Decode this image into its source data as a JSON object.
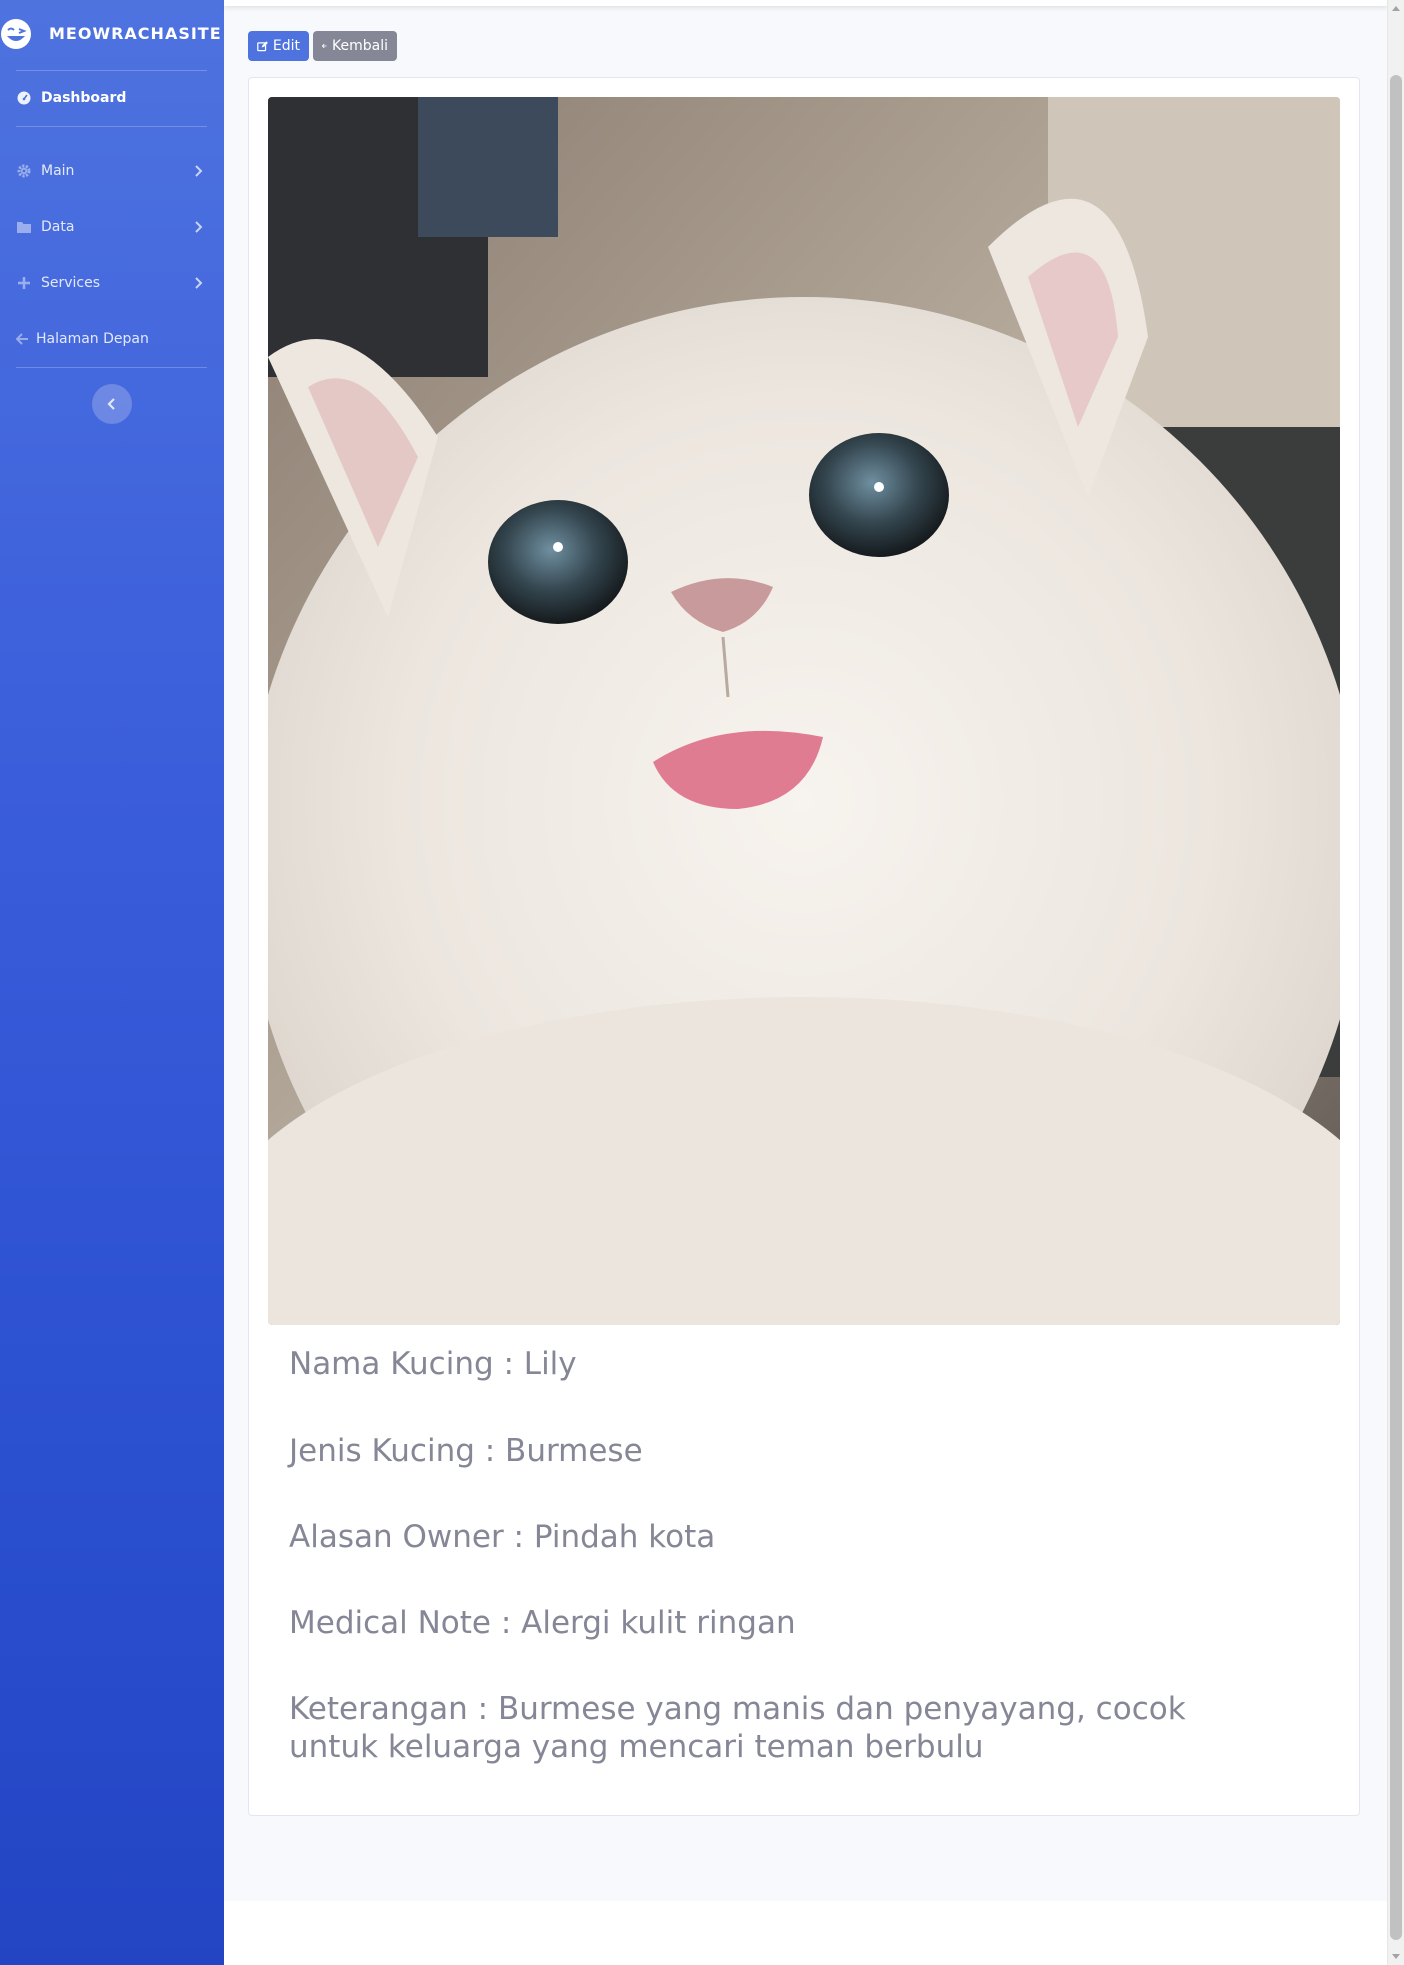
{
  "sidebar": {
    "brand": "MEOWRACHASITE",
    "items": [
      {
        "label": "Dashboard",
        "icon": "tachometer-icon"
      },
      {
        "label": "Main",
        "icon": "gear-icon"
      },
      {
        "label": "Data",
        "icon": "folder-icon"
      },
      {
        "label": "Services",
        "icon": "plus-icon"
      },
      {
        "label": "Halaman Depan",
        "icon": "arrow-left-icon"
      }
    ]
  },
  "toolbar": {
    "edit_label": "Edit",
    "back_label": "Kembali"
  },
  "cat": {
    "name": "Nama Kucing : Lily",
    "breed": "Jenis Kucing : Burmese",
    "reason": "Alasan Owner : Pindah kota",
    "medical": "Medical Note : Alergi kulit ringan",
    "notes": "Keterangan : Burmese yang manis dan penyayang, cocok untuk keluarga yang mencari teman berbulu"
  },
  "colors": {
    "primary": "#4e73df",
    "secondary": "#858796",
    "text_muted": "#858796"
  }
}
